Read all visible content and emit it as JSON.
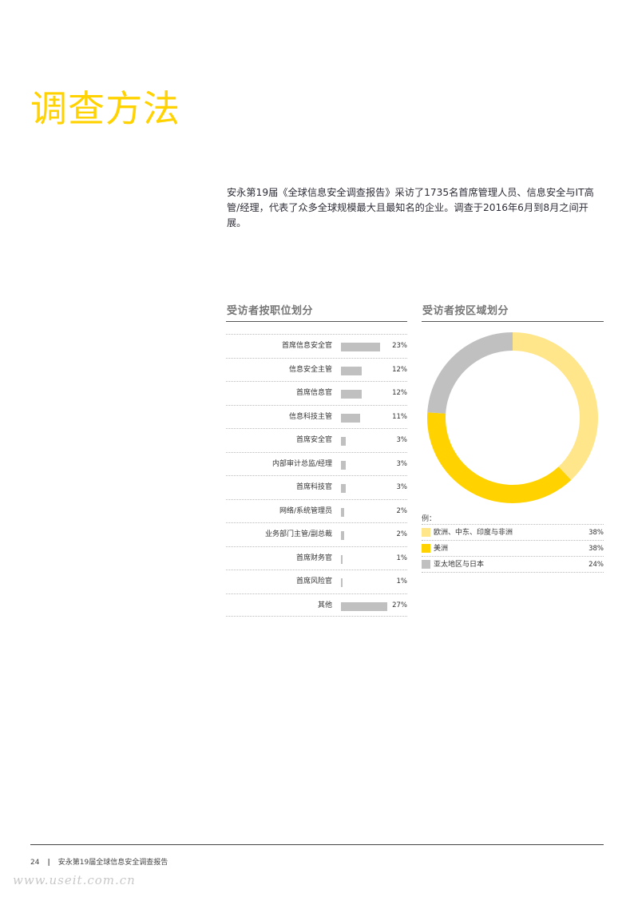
{
  "page": {
    "title": "调查方法",
    "intro": "安永第19届《全球信息安全调查报告》采访了1735名首席管理人员、信息安全与IT高管/经理，代表了众多全球规模最大且最知名的企业。调查于2016年6月到8月之间开展。"
  },
  "colors": {
    "accent": "#ffd200",
    "light_yellow": "#ffe68a",
    "grey": "#c0c0c0"
  },
  "chart_data": [
    {
      "type": "bar",
      "title": "受访者按职位划分",
      "categories": [
        "首席信息安全官",
        "信息安全主管",
        "首席信息官",
        "信息科技主管",
        "首席安全官",
        "内部审计总监/经理",
        "首席科技官",
        "网络/系统管理员",
        "业务部门主管/副总裁",
        "首席财务官",
        "首席风险官",
        "其他"
      ],
      "values": [
        23,
        12,
        12,
        11,
        3,
        3,
        3,
        2,
        2,
        1,
        1,
        27
      ],
      "value_labels": [
        "23%",
        "12%",
        "12%",
        "11%",
        "3%",
        "3%",
        "3%",
        "2%",
        "2%",
        "1%",
        "1%",
        "27%"
      ],
      "xlim": [
        0,
        27
      ]
    },
    {
      "type": "pie",
      "title": "受访者按区域划分",
      "legend_caption": "例：",
      "categories": [
        "欧洲、中东、印度与非洲",
        "美洲",
        "亚太地区与日本"
      ],
      "values": [
        38,
        38,
        24
      ],
      "value_labels": [
        "38%",
        "38%",
        "24%"
      ],
      "colors": [
        "#ffe68a",
        "#ffd200",
        "#c0c0c0"
      ]
    }
  ],
  "footer": {
    "page_number": "24",
    "separator": "|",
    "text": "安永第19届全球信息安全调查报告"
  },
  "watermark": "www.useit.com.cn"
}
